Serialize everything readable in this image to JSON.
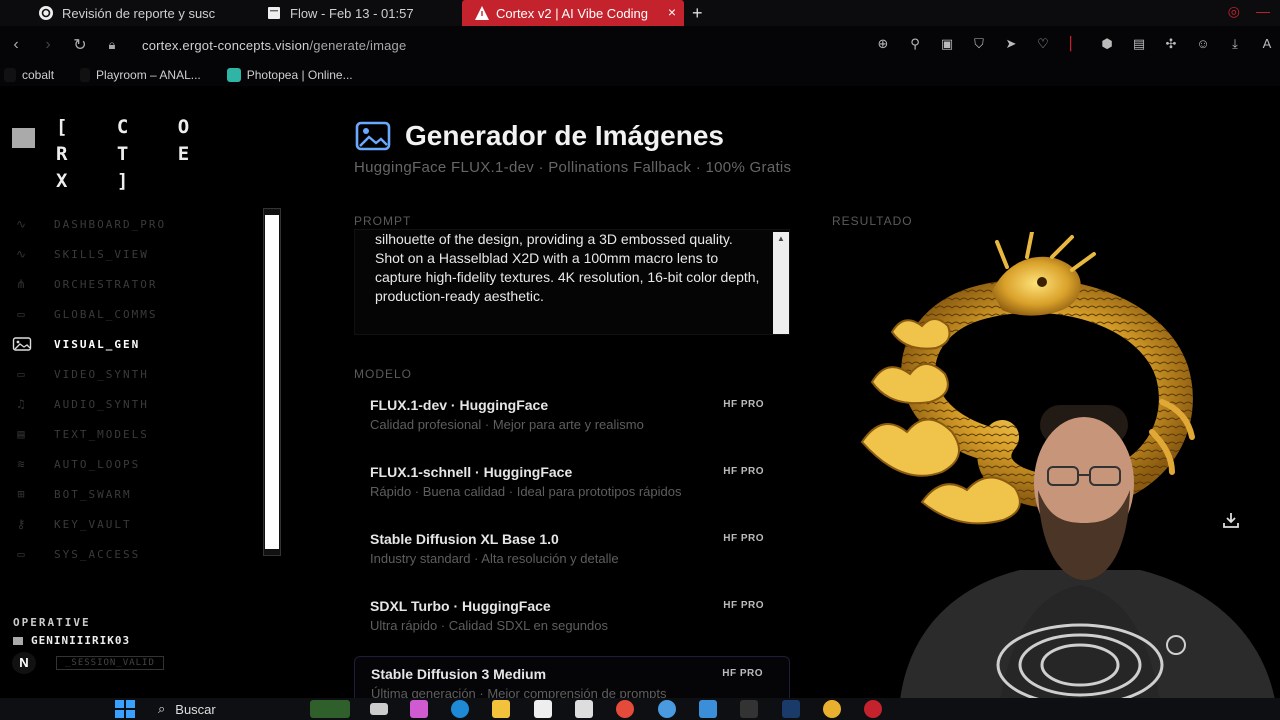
{
  "browser": {
    "tabs": [
      {
        "label": "Revisión de reporte y susc",
        "icon": "chatgpt-icon"
      },
      {
        "label": "Flow - Feb 13 - 01:57",
        "icon": "document-icon"
      },
      {
        "label": "Cortex v2 | AI Vibe Coding",
        "icon": "warning-triangle-icon",
        "active": true
      }
    ],
    "url_domain": "cortex.ergot-concepts.vision",
    "url_path": "/generate/image",
    "bookmarks": [
      "cobalt",
      "Playroom – ANAL...",
      "Photopea | Online..."
    ]
  },
  "sidebar": {
    "logo": "[ C O R T E X ]",
    "items": [
      {
        "label": "DASHBOARD_PRO",
        "icon": "activity-icon"
      },
      {
        "label": "SKILLS_VIEW",
        "icon": "activity-icon"
      },
      {
        "label": "ORCHESTRATOR",
        "icon": "share-icon"
      },
      {
        "label": "GLOBAL_COMMS",
        "icon": "chat-icon"
      },
      {
        "label": "VISUAL_GEN",
        "icon": "image-icon",
        "active": true
      },
      {
        "label": "VIDEO_SYNTH",
        "icon": "video-icon"
      },
      {
        "label": "AUDIO_SYNTH",
        "icon": "audio-icon"
      },
      {
        "label": "TEXT_MODELS",
        "icon": "text-icon"
      },
      {
        "label": "AUTO_LOOPS",
        "icon": "loop-icon"
      },
      {
        "label": "BOT_SWARM",
        "icon": "bot-icon"
      },
      {
        "label": "KEY_VAULT",
        "icon": "key-icon"
      },
      {
        "label": "SYS_ACCESS",
        "icon": "settings-icon"
      }
    ],
    "operative_label": "OPERATIVE",
    "username": "GENINIIIRIK03",
    "session": "_SESSION_VALID"
  },
  "main": {
    "title": "Generador de Imágenes",
    "subtitle": "HuggingFace FLUX.1-dev · Pollinations Fallback · 100% Gratis",
    "prompt_label": "PROMPT",
    "prompt_text": "silhouette of the design, providing a 3D embossed quality. Shot on a Hasselblad X2D with a 100mm macro lens to capture high-fidelity textures. 4K resolution, 16-bit color depth, production-ready aesthetic.",
    "model_label": "MODELO",
    "result_label": "RESULTADO",
    "models": [
      {
        "name": "FLUX.1-dev · HuggingFace",
        "desc": "Calidad profesional · Mejor para arte y realismo",
        "badge": "HF PRO"
      },
      {
        "name": "FLUX.1-schnell · HuggingFace",
        "desc": "Rápido · Buena calidad · Ideal para prototipos rápidos",
        "badge": "HF PRO"
      },
      {
        "name": "Stable Diffusion XL Base 1.0",
        "desc": "Industry standard · Alta resolución y detalle",
        "badge": "HF PRO"
      },
      {
        "name": "SDXL Turbo · HuggingFace",
        "desc": "Ultra rápido · Calidad SDXL en segundos",
        "badge": "HF PRO"
      },
      {
        "name": "Stable Diffusion 3 Medium",
        "desc": "Última generación · Mejor comprensión de prompts",
        "badge": "HF PRO",
        "selected": true
      }
    ]
  },
  "taskbar": {
    "search_label": "Buscar"
  }
}
